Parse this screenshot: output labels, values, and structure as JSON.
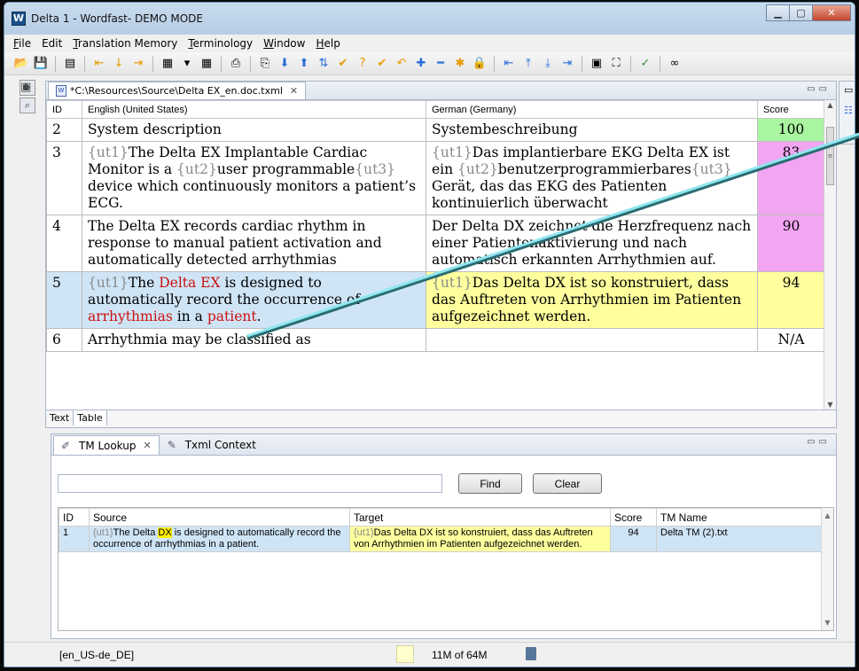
{
  "window": {
    "title": "Delta 1 - Wordfast- DEMO MODE",
    "controls": [
      "▁",
      "▢",
      "✕"
    ]
  },
  "menu": [
    {
      "mnemonic": "F",
      "rest": "ile"
    },
    {
      "mnemonic": "",
      "rest": "Edit"
    },
    {
      "mnemonic": "T",
      "rest": "ranslation Memory"
    },
    {
      "mnemonic": "T",
      "rest": "erminology"
    },
    {
      "mnemonic": "W",
      "rest": "indow"
    },
    {
      "mnemonic": "H",
      "rest": "elp"
    }
  ],
  "toolbar_icons": [
    "open-icon",
    "save-icon",
    "sep",
    "doc-icon",
    "sep",
    "prev-segment-icon",
    "down-icon",
    "next-segment-icon",
    "sep",
    "segment-icon",
    "dropdown-icon",
    "segment2-icon",
    "sep",
    "print-icon",
    "sep",
    "copy-source-icon",
    "arrow-down-icon",
    "arrow-up-icon",
    "arrows-icon",
    "check-icon",
    "question-icon",
    "check2-icon",
    "undo-icon",
    "plus-icon",
    "minus-icon",
    "star-icon",
    "lock-icon",
    "sep",
    "first-icon",
    "top-icon",
    "bottom-icon",
    "last-icon",
    "sep",
    "grid-icon",
    "fit-icon",
    "sep",
    "spellcheck-icon",
    "sep",
    "link-icon"
  ],
  "editor": {
    "tab_label": "*C:\\Resources\\Source\\Delta EX_en.doc.txml",
    "columns": {
      "id": "ID",
      "source": "English (United States)",
      "target": "German (Germany)",
      "score": "Score"
    },
    "rows": [
      {
        "id": "2",
        "source": [
          {
            "t": "System description"
          }
        ],
        "target": [
          {
            "t": "Systembeschreibung"
          }
        ],
        "score": "100",
        "score_color": "#a9f5a0"
      },
      {
        "id": "3",
        "source": [
          {
            "c": "{ut1}"
          },
          {
            "t": "The Delta EX Implantable Cardiac Monitor is a "
          },
          {
            "c": "{ut2}"
          },
          {
            "t": "user programmable"
          },
          {
            "c": "{ut3}"
          },
          {
            "t": " device which continuously monitors a patient’s ECG."
          }
        ],
        "target": [
          {
            "c": "{ut1}"
          },
          {
            "t": "Das implantierbare EKG Delta EX ist ein "
          },
          {
            "c": "{ut2}"
          },
          {
            "t": "benutzerprogrammierbares"
          },
          {
            "c": "{ut3}"
          },
          {
            "t": " Gerät, das das EKG des Patienten kontinuierlich überwacht"
          }
        ],
        "score": "83",
        "score_color": "#f2a6f2"
      },
      {
        "id": "4",
        "source": [
          {
            "t": "The Delta EX records cardiac rhythm in response to manual patient activation and automatically detected arrhythmias"
          }
        ],
        "target": [
          {
            "t": "Der Delta DX zeichnet die Herzfrequenz nach einer Patientenaktivierung und nach automatisch erkannten Arrhythmien auf."
          }
        ],
        "score": "90",
        "score_color": "#f2a6f2"
      },
      {
        "id": "5",
        "active": true,
        "source": [
          {
            "c": "{ut1}"
          },
          {
            "t": "The "
          },
          {
            "r": "Delta EX"
          },
          {
            "t": " is designed to automatically record the occurrence of "
          },
          {
            "r": "arrhythmias"
          },
          {
            "t": " in a "
          },
          {
            "r": "patient"
          },
          {
            "t": "."
          }
        ],
        "target": [
          {
            "c": "{ut1}"
          },
          {
            "t": "Das Delta DX ist so konstruiert, dass das Auftreten von Arrhythmien im Patienten aufgezeichnet werden."
          }
        ],
        "score": "94",
        "score_color": "#ffff9e"
      },
      {
        "id": "6",
        "source": [
          {
            "t": "Arrhythmia may be classified as"
          }
        ],
        "target": [
          {
            "t": ""
          }
        ],
        "score": "N/A",
        "score_color": "#ffffff"
      }
    ],
    "view_tabs": [
      "Text",
      "Table"
    ]
  },
  "lookup": {
    "tabs": [
      "TM Lookup",
      "Txml Context"
    ],
    "input_value": "",
    "find_label": "Find",
    "clear_label": "Clear",
    "columns": {
      "id": "ID",
      "source": "Source",
      "target": "Target",
      "score": "Score",
      "tm_name": "TM Name"
    },
    "rows": [
      {
        "id": "1",
        "source_code": "{ut1}",
        "source_pre": "The Delta ",
        "source_hl": "DX",
        "source_post": " is designed to automatically record the occurrence of arrhythmias in a patient.",
        "target_code": "{ut1}",
        "target_text": "Das Delta DX ist so konstruiert, dass das Auftreten von Arrhythmien im Patienten aufgezeichnet werden.",
        "score": "94",
        "tm_name": "Delta TM (2).txt"
      }
    ]
  },
  "status": {
    "locale": "[en_US-de_DE]",
    "memory": "11M of 64M"
  },
  "colors": {
    "arrow": "#8fe6f0",
    "active_row": "#cfe5f6",
    "target_active": "#ffff9e",
    "term": "#cc1111"
  }
}
